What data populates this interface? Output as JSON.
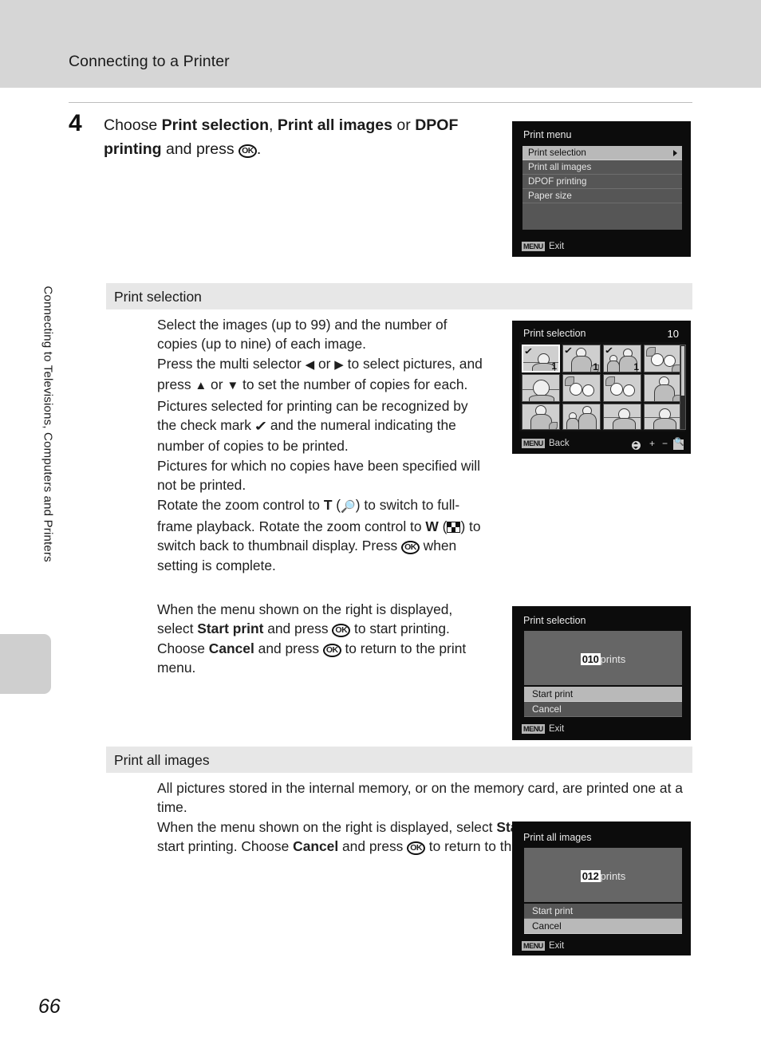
{
  "header": {
    "title": "Connecting to a Printer"
  },
  "sidebar": {
    "vertical_label": "Connecting to Televisions, Computers and Printers"
  },
  "page": {
    "number": "66"
  },
  "step": {
    "number": "4",
    "text_html": "Choose <b>Print selection</b>, <b>Print all images</b> or <b>DPOF printing</b> and press <span class=\"ok-glyph\">OK</span>."
  },
  "sections": [
    {
      "title": "Print selection"
    },
    {
      "title": "Print all images"
    }
  ],
  "paragraphs": {
    "print_selection_body_html": "Select the images (up to 99) and the number of copies (up to nine) of each image.<br>Press the multi selector <span class=\"tri\">&#9664;</span> or <span class=\"tri\">&#9654;</span> to select pictures, and press <span class=\"tri\">&#9650;</span> or <span class=\"tri\">&#9660;</span> to set the number of copies for each.<br>Pictures selected for printing can be recognized by the check mark <span class=\"check-glyph\">&#10003;</span> and the numeral indicating the number of copies to be printed.<br>Pictures for which no copies have been specified will not be printed.<br>Rotate the zoom control to <b class=\"zoom-t\">T</b> (<span class=\"mag-glyph\">&#128269;</span>) to switch to full-frame playback. Rotate the zoom control to <b class=\"zoom-t\">W</b> (<span class=\"thumb-glyph\"></span>) to switch back to thumbnail display. Press <span class=\"ok-glyph\">OK</span> when setting is complete.",
    "print_selection_confirm_html": "When the menu shown on the right is displayed, select <b>Start print</b> and press <span class=\"ok-glyph\">OK</span> to start printing. Choose <b>Cancel</b> and press <span class=\"ok-glyph\">OK</span> to return to the print menu.",
    "print_all_body_html": "All pictures stored in the internal memory, or on the memory card, are printed one at a time.<br>When the menu shown on the right is displayed, select <b>Start print</b> and press <span class=\"ok-glyph\">OK</span> to start printing. Choose <b>Cancel</b> and press <span class=\"ok-glyph\">OK</span> to return to the print menu."
  },
  "screens": {
    "print_menu": {
      "title": "Print menu",
      "items": [
        {
          "label": "Print selection",
          "selected": true,
          "has_arrow": true
        },
        {
          "label": "Print all images",
          "selected": false,
          "has_arrow": false
        },
        {
          "label": "DPOF printing",
          "selected": false,
          "has_arrow": false
        },
        {
          "label": "Paper size",
          "selected": false,
          "has_arrow": false
        }
      ],
      "bottom_badge": "MENU",
      "bottom_label": "Exit"
    },
    "print_selection_grid": {
      "title": "Print selection",
      "count": "10",
      "bottom_badge": "MENU",
      "bottom_label": "Back",
      "icons": {
        "updown": "updown-icon",
        "plus": "+",
        "minus": "−",
        "zoom": "magnifier-icon"
      },
      "thumbnails": [
        {
          "check": true,
          "copies": "1",
          "selected": true,
          "kind": "portrait-landscape"
        },
        {
          "check": true,
          "copies": "1",
          "selected": false,
          "kind": "person-bag"
        },
        {
          "check": true,
          "copies": "1",
          "selected": false,
          "kind": "two-people"
        },
        {
          "check": false,
          "copies": "",
          "selected": false,
          "kind": "flowers"
        },
        {
          "check": false,
          "copies": "",
          "selected": false,
          "kind": "portrait-closeup"
        },
        {
          "check": false,
          "copies": "",
          "selected": false,
          "kind": "flowers"
        },
        {
          "check": false,
          "copies": "",
          "selected": false,
          "kind": "flowers"
        },
        {
          "check": false,
          "copies": "",
          "selected": false,
          "kind": "person-bag"
        },
        {
          "check": false,
          "copies": "",
          "selected": false,
          "kind": "person-bag"
        },
        {
          "check": false,
          "copies": "",
          "selected": false,
          "kind": "two-people"
        },
        {
          "check": false,
          "copies": "",
          "selected": false,
          "kind": "portrait-landscape"
        },
        {
          "check": false,
          "copies": "",
          "selected": false,
          "kind": "portrait-landscape"
        }
      ]
    },
    "print_selection_confirm": {
      "title": "Print selection",
      "count_value": "010",
      "count_unit": "prints",
      "options": [
        {
          "label": "Start print",
          "selected": true
        },
        {
          "label": "Cancel",
          "selected": false
        }
      ],
      "bottom_badge": "MENU",
      "bottom_label": "Exit"
    },
    "print_all_confirm": {
      "title": "Print all images",
      "count_value": "012",
      "count_unit": "prints",
      "options": [
        {
          "label": "Start print",
          "selected": false
        },
        {
          "label": "Cancel",
          "selected": true
        }
      ],
      "bottom_badge": "MENU",
      "bottom_label": "Exit"
    }
  },
  "colors": {
    "header_band": "#d6d6d6",
    "section_band": "#e7e7e7",
    "screen_bg": "#0c0c0c",
    "row_bg": "#565656",
    "row_selected": "#b9b9b9",
    "panel_bg": "#666666"
  }
}
